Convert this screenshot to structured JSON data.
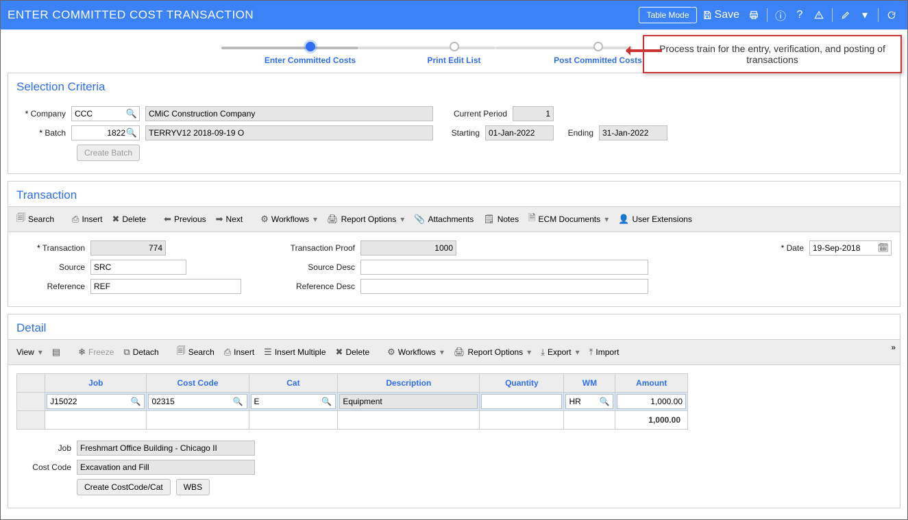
{
  "header": {
    "title": "ENTER COMMITTED COST TRANSACTION",
    "table_mode": "Table Mode",
    "save": "Save"
  },
  "train": {
    "steps": [
      "Enter Committed Costs",
      "Print Edit List",
      "Post Committed Costs"
    ]
  },
  "callout": "Process train for the entry, verification, and posting of transactions",
  "sel": {
    "title": "Selection Criteria",
    "company_lbl": "Company",
    "company": "CCC",
    "company_name": "CMiC Construction Company",
    "period_lbl": "Current Period",
    "period": "1",
    "batch_lbl": "Batch",
    "batch": "1822",
    "batch_desc": "TERRYV12 2018-09-19 O",
    "starting_lbl": "Starting",
    "starting": "01-Jan-2022",
    "ending_lbl": "Ending",
    "ending": "31-Jan-2022",
    "create_batch": "Create Batch"
  },
  "txn": {
    "title": "Transaction",
    "toolbar": {
      "search": "Search",
      "insert": "Insert",
      "delete": "Delete",
      "previous": "Previous",
      "next": "Next",
      "workflows": "Workflows",
      "report": "Report Options",
      "attachments": "Attachments",
      "notes": "Notes",
      "ecm": "ECM Documents",
      "userext": "User Extensions"
    },
    "tx_lbl": "Transaction",
    "tx": "774",
    "proof_lbl": "Transaction Proof",
    "proof": "1000",
    "date_lbl": "Date",
    "date": "19-Sep-2018",
    "source_lbl": "Source",
    "source": "SRC",
    "sourcedesc_lbl": "Source Desc",
    "sourcedesc": "",
    "ref_lbl": "Reference",
    "ref": "REF",
    "refdesc_lbl": "Reference Desc",
    "refdesc": ""
  },
  "detail": {
    "title": "Detail",
    "toolbar": {
      "view": "View",
      "freeze": "Freeze",
      "detach": "Detach",
      "search": "Search",
      "insert": "Insert",
      "insertm": "Insert Multiple",
      "delete": "Delete",
      "workflows": "Workflows",
      "report": "Report Options",
      "export": "Export",
      "import": "Import"
    },
    "cols": {
      "job": "Job",
      "cc": "Cost Code",
      "cat": "Cat",
      "desc": "Description",
      "qty": "Quantity",
      "wm": "WM",
      "amt": "Amount"
    },
    "rows": [
      {
        "job": "J15022",
        "cc": "02315",
        "cat": "E",
        "desc": "Equipment",
        "qty": "",
        "wm": "HR",
        "amt": "1,000.00"
      }
    ],
    "total": "1,000.00",
    "job_lbl": "Job",
    "job_desc": "Freshmart Office Building - Chicago II",
    "cc_lbl": "Cost Code",
    "cc_desc": "Excavation and Fill",
    "createcc": "Create CostCode/Cat",
    "wbs": "WBS"
  }
}
